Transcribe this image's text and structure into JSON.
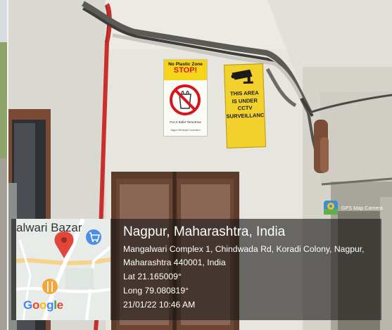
{
  "photo": {
    "signs": {
      "plastic": {
        "title": "No Plastic Zone",
        "stop": "STOP!",
        "tagline": "For A Safer Tomorrow",
        "footer": "Nagpur Municipal Corporation"
      },
      "cctv": {
        "lines": [
          "THIS AREA",
          "IS UNDER",
          "CCTV",
          "SURVEILLANCE"
        ]
      }
    }
  },
  "gps_overlay": {
    "badge": "GPS Map Camera",
    "map": {
      "label": "alwari Bazar",
      "logo": "Google"
    },
    "location_title": "Nagpur, Maharashtra, India",
    "address": "Mangalwari Complex 1, Chindwada Rd, Koradi Colony, Nagpur, Maharashtra 440001, India",
    "lat": "Lat 21.165009°",
    "long": "Long 79.080819°",
    "datetime": "21/01/22 10:46 AM"
  },
  "colors": {
    "overlay": "#1c1a18",
    "sign_yellow": "#f3d12c",
    "stop_red": "#d7161b",
    "map_pin": "#e0463a"
  }
}
